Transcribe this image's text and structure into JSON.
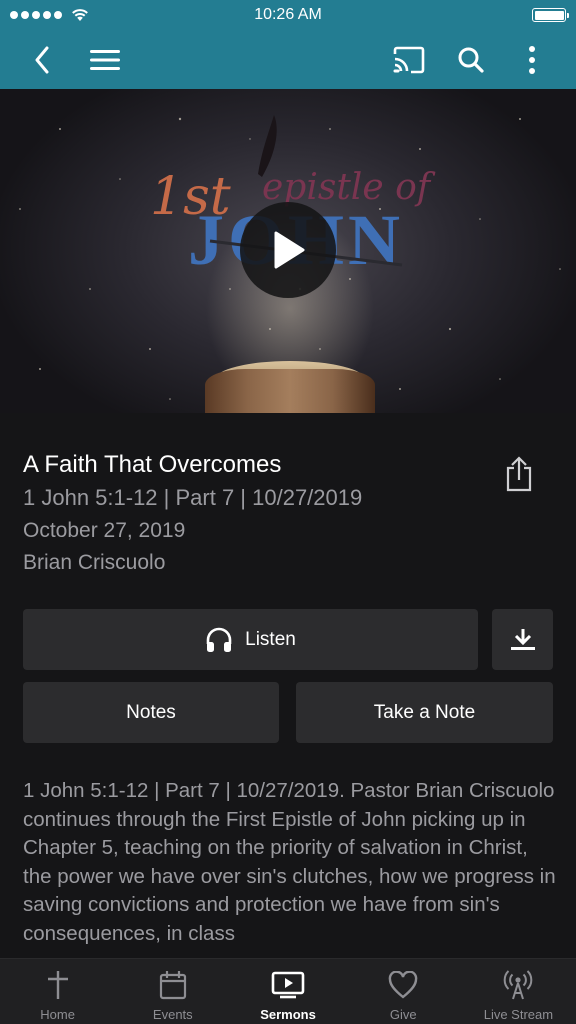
{
  "status_bar": {
    "time": "10:26 AM"
  },
  "header": {
    "back_icon": "chevron-left-icon",
    "menu_icon": "hamburger-menu-icon",
    "cast_icon": "cast-icon",
    "search_icon": "search-icon",
    "more_icon": "more-vertical-icon",
    "background_color": "#237d92"
  },
  "hero": {
    "artwork_text": "1st Epistle of JOHN",
    "play_icon": "play-icon"
  },
  "sermon": {
    "title": "A Faith That Overcomes",
    "subtitle": "1 John 5:1-12 | Part 7 | 10/27/2019",
    "date": "October 27, 2019",
    "speaker": "Brian Criscuolo",
    "description": "1 John 5:1-12 | Part 7 | 10/27/2019. Pastor Brian Criscuolo continues through the First Epistle of John picking up in Chapter 5, teaching on the priority of salvation in Christ, the power we have over sin's clutches, how we progress in saving convictions and protection we have from sin's consequences, in class"
  },
  "actions": {
    "listen_label": "Listen",
    "notes_label": "Notes",
    "take_note_label": "Take a Note"
  },
  "tabs": [
    {
      "label": "Home",
      "icon": "cross-icon",
      "active": false
    },
    {
      "label": "Events",
      "icon": "calendar-icon",
      "active": false
    },
    {
      "label": "Sermons",
      "icon": "video-play-icon",
      "active": true
    },
    {
      "label": "Give",
      "icon": "heart-icon",
      "active": false
    },
    {
      "label": "Live Stream",
      "icon": "broadcast-icon",
      "active": false
    }
  ]
}
